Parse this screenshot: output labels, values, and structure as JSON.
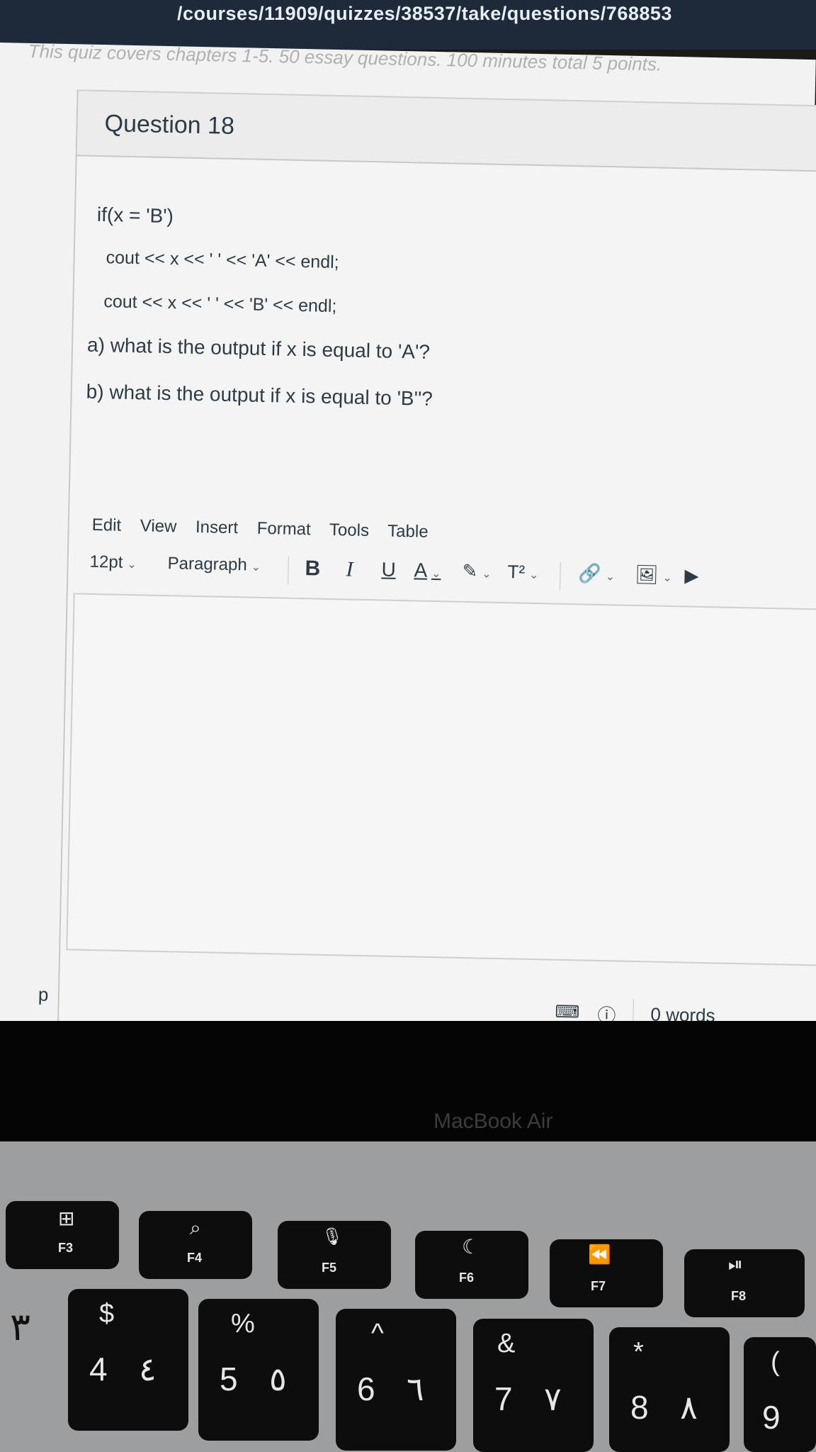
{
  "browser": {
    "url_visible": "/courses/11909/quizzes/38537/take/questions/768853"
  },
  "quiz": {
    "subtitle_visible": "This quiz covers chapters 1-5. 50 essay questions. 100 minutes total   5 points."
  },
  "question": {
    "title": "Question 18",
    "lines": [
      "if(x = 'B')",
      "cout << x << ' ' << 'A' << endl;",
      "cout << x << ' ' << 'B' << endl;",
      "a) what is the output if x is equal to 'A'?",
      "b) what is the output if x is equal to 'B''?"
    ]
  },
  "editor": {
    "menu": [
      "Edit",
      "View",
      "Insert",
      "Format",
      "Tools",
      "Table"
    ],
    "font_size": "12pt",
    "block_format": "Paragraph",
    "buttons": {
      "bold": "B",
      "italic": "I",
      "underline": "U",
      "text_color": "A",
      "superscript": "T²"
    },
    "path": "p",
    "word_count": "0 words"
  },
  "device": {
    "brand": "MacBook Air"
  },
  "keyboard": {
    "fkeys": [
      {
        "label": "F3",
        "icon": "⊞"
      },
      {
        "label": "F4",
        "icon": "⌕"
      },
      {
        "label": "F5",
        "icon": "🎙"
      },
      {
        "label": "F6",
        "icon": "☾"
      },
      {
        "label": "F7",
        "icon": "⏪"
      },
      {
        "label": "F8",
        "icon": "⏯"
      }
    ],
    "numkeys": [
      {
        "top": "$",
        "main": "4",
        "alt": "٤"
      },
      {
        "top": "%",
        "main": "5",
        "alt": "٥"
      },
      {
        "top": "^",
        "main": "6",
        "alt": "٦"
      },
      {
        "top": "&",
        "main": "7",
        "alt": "٧"
      },
      {
        "top": "*",
        "main": "8",
        "alt": "٨"
      },
      {
        "top": "(",
        "main": "9",
        "alt": ""
      }
    ],
    "edge_key_glyph": "٣"
  },
  "colors": {
    "text": "#2d3b45",
    "url_bar": "#1e2a3a",
    "page": "#f2f2f2"
  }
}
